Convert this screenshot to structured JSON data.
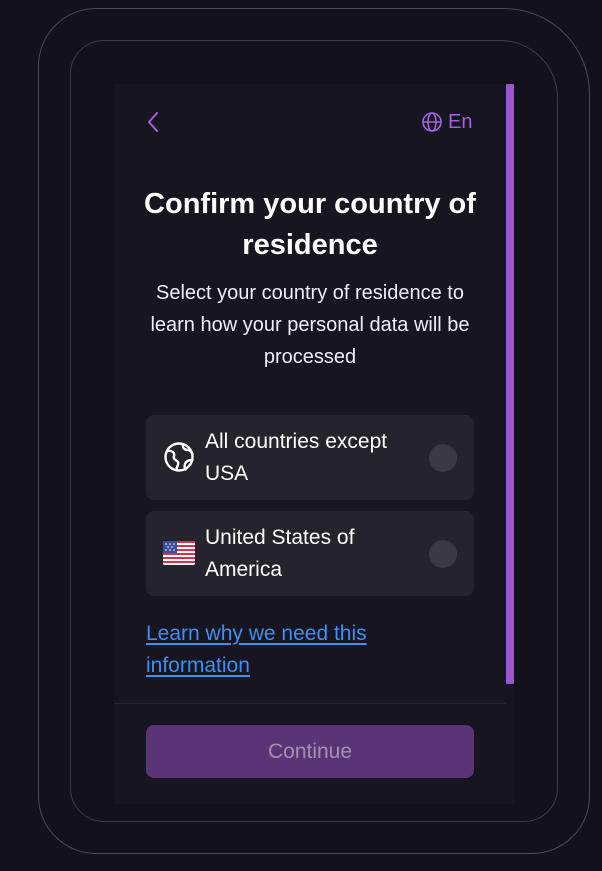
{
  "header": {
    "back_icon": "chevron-left-icon",
    "language_icon": "globe-icon",
    "language_label": "En"
  },
  "title": "Confirm your country of residence",
  "subtitle": "Select your country of residence to learn how your personal data will be processed",
  "options": [
    {
      "label": "All countries except USA",
      "icon": "world-globe-icon",
      "selected": false
    },
    {
      "label": "United States of America",
      "icon": "us-flag-icon",
      "selected": false
    }
  ],
  "learn_link": "Learn why we need this information",
  "continue_label": "Continue",
  "colors": {
    "accent": "#a460e0",
    "scrollbar": "#9c55d4",
    "link": "#3e8ef5",
    "button_disabled_bg": "#5b3377",
    "button_disabled_text": "#a292ad",
    "background": "#13121b",
    "option_bg": "#25242d"
  }
}
